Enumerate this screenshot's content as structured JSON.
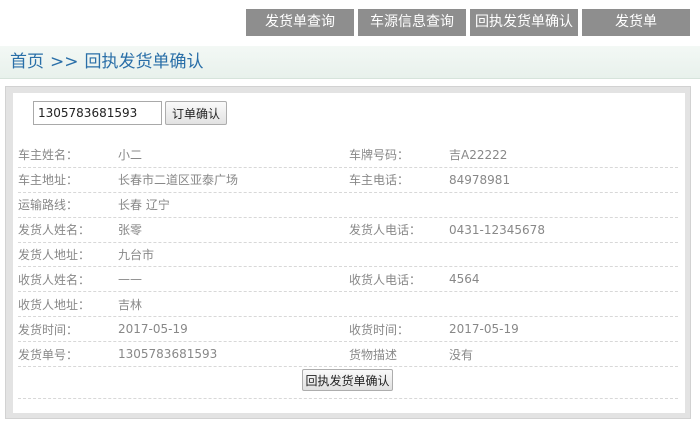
{
  "nav": {
    "items": [
      {
        "label": "发货单查询"
      },
      {
        "label": "车源信息查询"
      },
      {
        "label": "回执发货单确认"
      },
      {
        "label": "发货单"
      }
    ]
  },
  "breadcrumb": {
    "home": "首页",
    "separator": ">>",
    "current": "回执发货单确认"
  },
  "search": {
    "value": "1305783681593",
    "button_label": "订单确认"
  },
  "details": [
    {
      "k1": "车主姓名：",
      "v1": "小二",
      "k2": "车牌号码：",
      "v2": "吉A22222"
    },
    {
      "k1": "车主地址：",
      "v1": "长春市二道区亚泰广场",
      "k2": "车主电话：",
      "v2": "84978981"
    },
    {
      "k1": "运输路线：",
      "v1": "长春 辽宁",
      "k2": "",
      "v2": ""
    },
    {
      "k1": "发货人姓名：",
      "v1": "张零",
      "k2": "发货人电话：",
      "v2": "0431-12345678"
    },
    {
      "k1": "发货人地址：",
      "v1": "九台市",
      "k2": "",
      "v2": ""
    },
    {
      "k1": "收货人姓名：",
      "v1": "——",
      "k2": "收货人电话：",
      "v2": "4564"
    },
    {
      "k1": "收货人地址：",
      "v1": "吉林",
      "k2": "",
      "v2": ""
    },
    {
      "k1": "发货时间：",
      "v1": "2017-05-19",
      "k2": "收货时间：",
      "v2": "2017-05-19"
    },
    {
      "k1": "发货单号：",
      "v1": "1305783681593",
      "k2": "货物描述",
      "v2": "没有"
    }
  ],
  "confirm_button": "回执发货单确认"
}
